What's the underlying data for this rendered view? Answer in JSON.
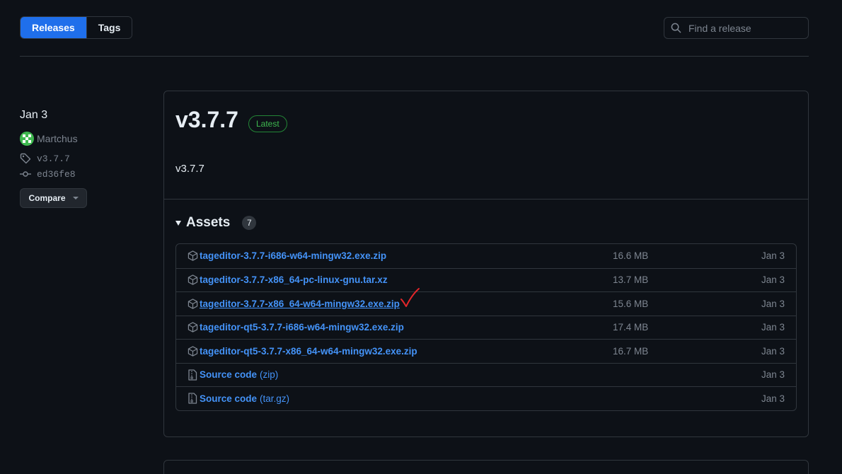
{
  "tabs": {
    "releases": "Releases",
    "tags": "Tags"
  },
  "search": {
    "placeholder": "Find a release"
  },
  "meta": {
    "date": "Jan 3",
    "author": "Martchus",
    "tag": "v3.7.7",
    "commit": "ed36fe8",
    "compare_label": "Compare"
  },
  "release": {
    "title": "v3.7.7",
    "badge": "Latest",
    "body": "v3.7.7"
  },
  "assets": {
    "label": "Assets",
    "count": "7",
    "items": [
      {
        "name": "tageditor-3.7.7-i686-w64-mingw32.exe.zip",
        "suffix": "",
        "size": "16.6 MB",
        "date": "Jan 3"
      },
      {
        "name": "tageditor-3.7.7-x86_64-pc-linux-gnu.tar.xz",
        "suffix": "",
        "size": "13.7 MB",
        "date": "Jan 3"
      },
      {
        "name": "tageditor-3.7.7-x86_64-w64-mingw32.exe.zip",
        "suffix": "",
        "size": "15.6 MB",
        "date": "Jan 3"
      },
      {
        "name": "tageditor-qt5-3.7.7-i686-w64-mingw32.exe.zip",
        "suffix": "",
        "size": "17.4 MB",
        "date": "Jan 3"
      },
      {
        "name": "tageditor-qt5-3.7.7-x86_64-w64-mingw32.exe.zip",
        "suffix": "",
        "size": "16.7 MB",
        "date": "Jan 3"
      },
      {
        "name": "Source code",
        "suffix": "(zip)",
        "size": "",
        "date": "Jan 3"
      },
      {
        "name": "Source code",
        "suffix": "(tar.gz)",
        "size": "",
        "date": "Jan 3"
      }
    ]
  },
  "colors": {
    "accent": "#1f6feb",
    "link": "#4493f8",
    "latest": "#3fb950",
    "annotation": "#e5262a"
  }
}
